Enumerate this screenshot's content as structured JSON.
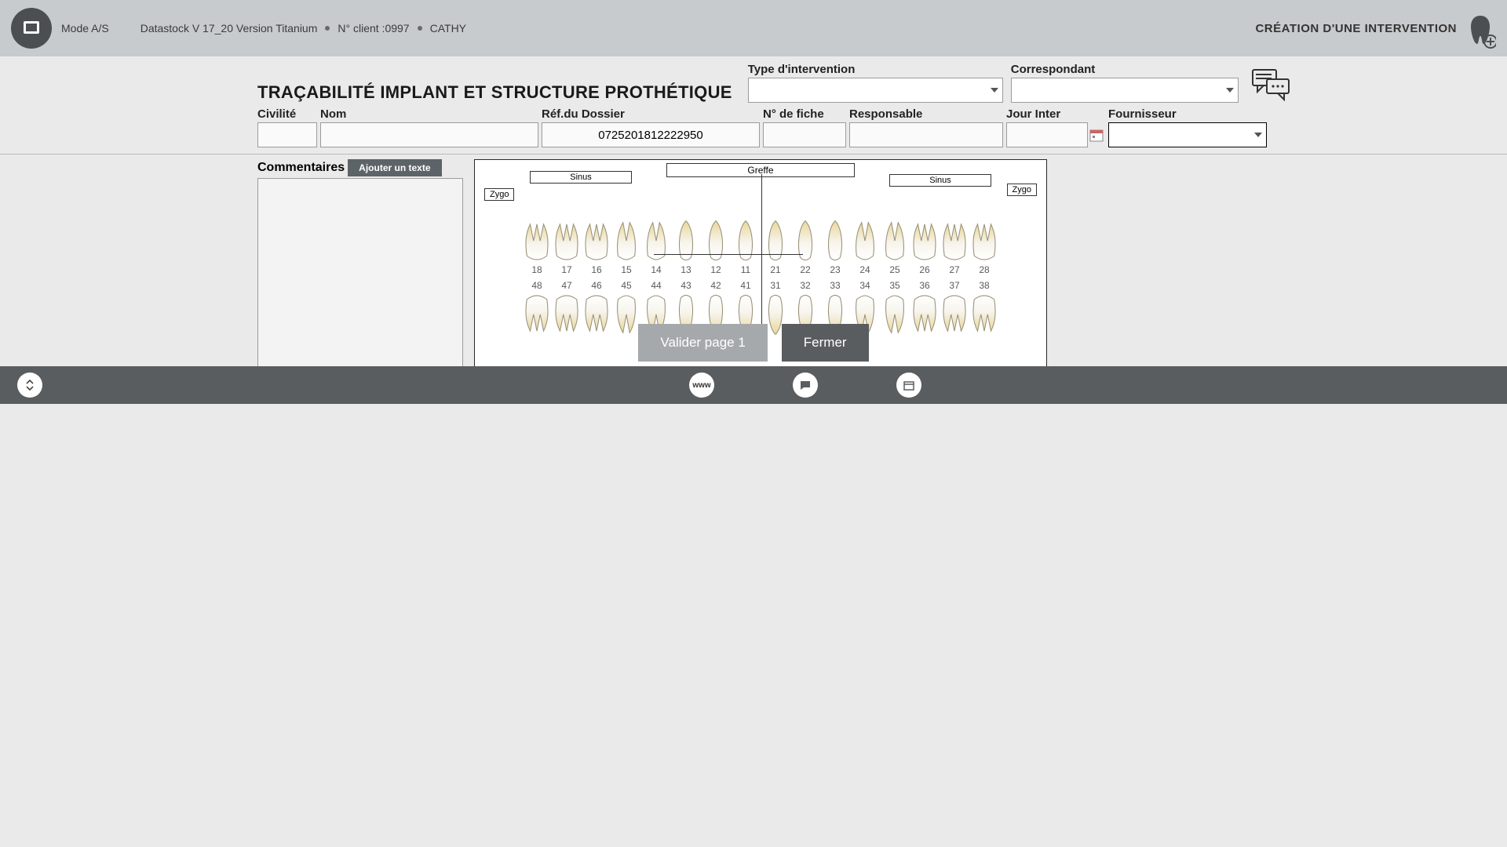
{
  "topbar": {
    "mode": "Mode A/S",
    "version": "Datastock V 17_20 Version Titanium",
    "client_num_label": "N° client :",
    "client_num": "0997",
    "user": "CATHY",
    "page_title": "CRÉATION D'UNE INTERVENTION"
  },
  "title": "TRAÇABILITÉ IMPLANT ET STRUCTURE PROTHÉTIQUE",
  "fields": {
    "type_intervention": {
      "label": "Type d'intervention",
      "value": ""
    },
    "correspondant": {
      "label": "Correspondant",
      "value": ""
    },
    "civilite": {
      "label": "Civilité",
      "value": ""
    },
    "nom": {
      "label": "Nom",
      "value": ""
    },
    "ref_dossier": {
      "label": "Réf.du Dossier",
      "value": "0725201812222950"
    },
    "num_fiche": {
      "label": "N° de fiche",
      "value": ""
    },
    "responsable": {
      "label": "Responsable",
      "value": ""
    },
    "jour_inter": {
      "label": "Jour Inter",
      "value": ""
    },
    "fournisseur": {
      "label": "Fournisseur",
      "value": ""
    }
  },
  "comments": {
    "label": "Commentaires",
    "add_text": "Ajouter un texte",
    "value": ""
  },
  "dental": {
    "greffe": "Greffe",
    "sinus": "Sinus",
    "zygo": "Zygo",
    "upper_teeth": [
      "18",
      "17",
      "16",
      "15",
      "14",
      "13",
      "12",
      "11",
      "21",
      "22",
      "23",
      "24",
      "25",
      "26",
      "27",
      "28"
    ],
    "lower_teeth": [
      "48",
      "47",
      "46",
      "45",
      "44",
      "43",
      "42",
      "41",
      "31",
      "32",
      "33",
      "34",
      "35",
      "36",
      "37",
      "38"
    ]
  },
  "actions": {
    "validate": "Valider page 1",
    "close": "Fermer"
  },
  "footer": {
    "www": "www"
  }
}
